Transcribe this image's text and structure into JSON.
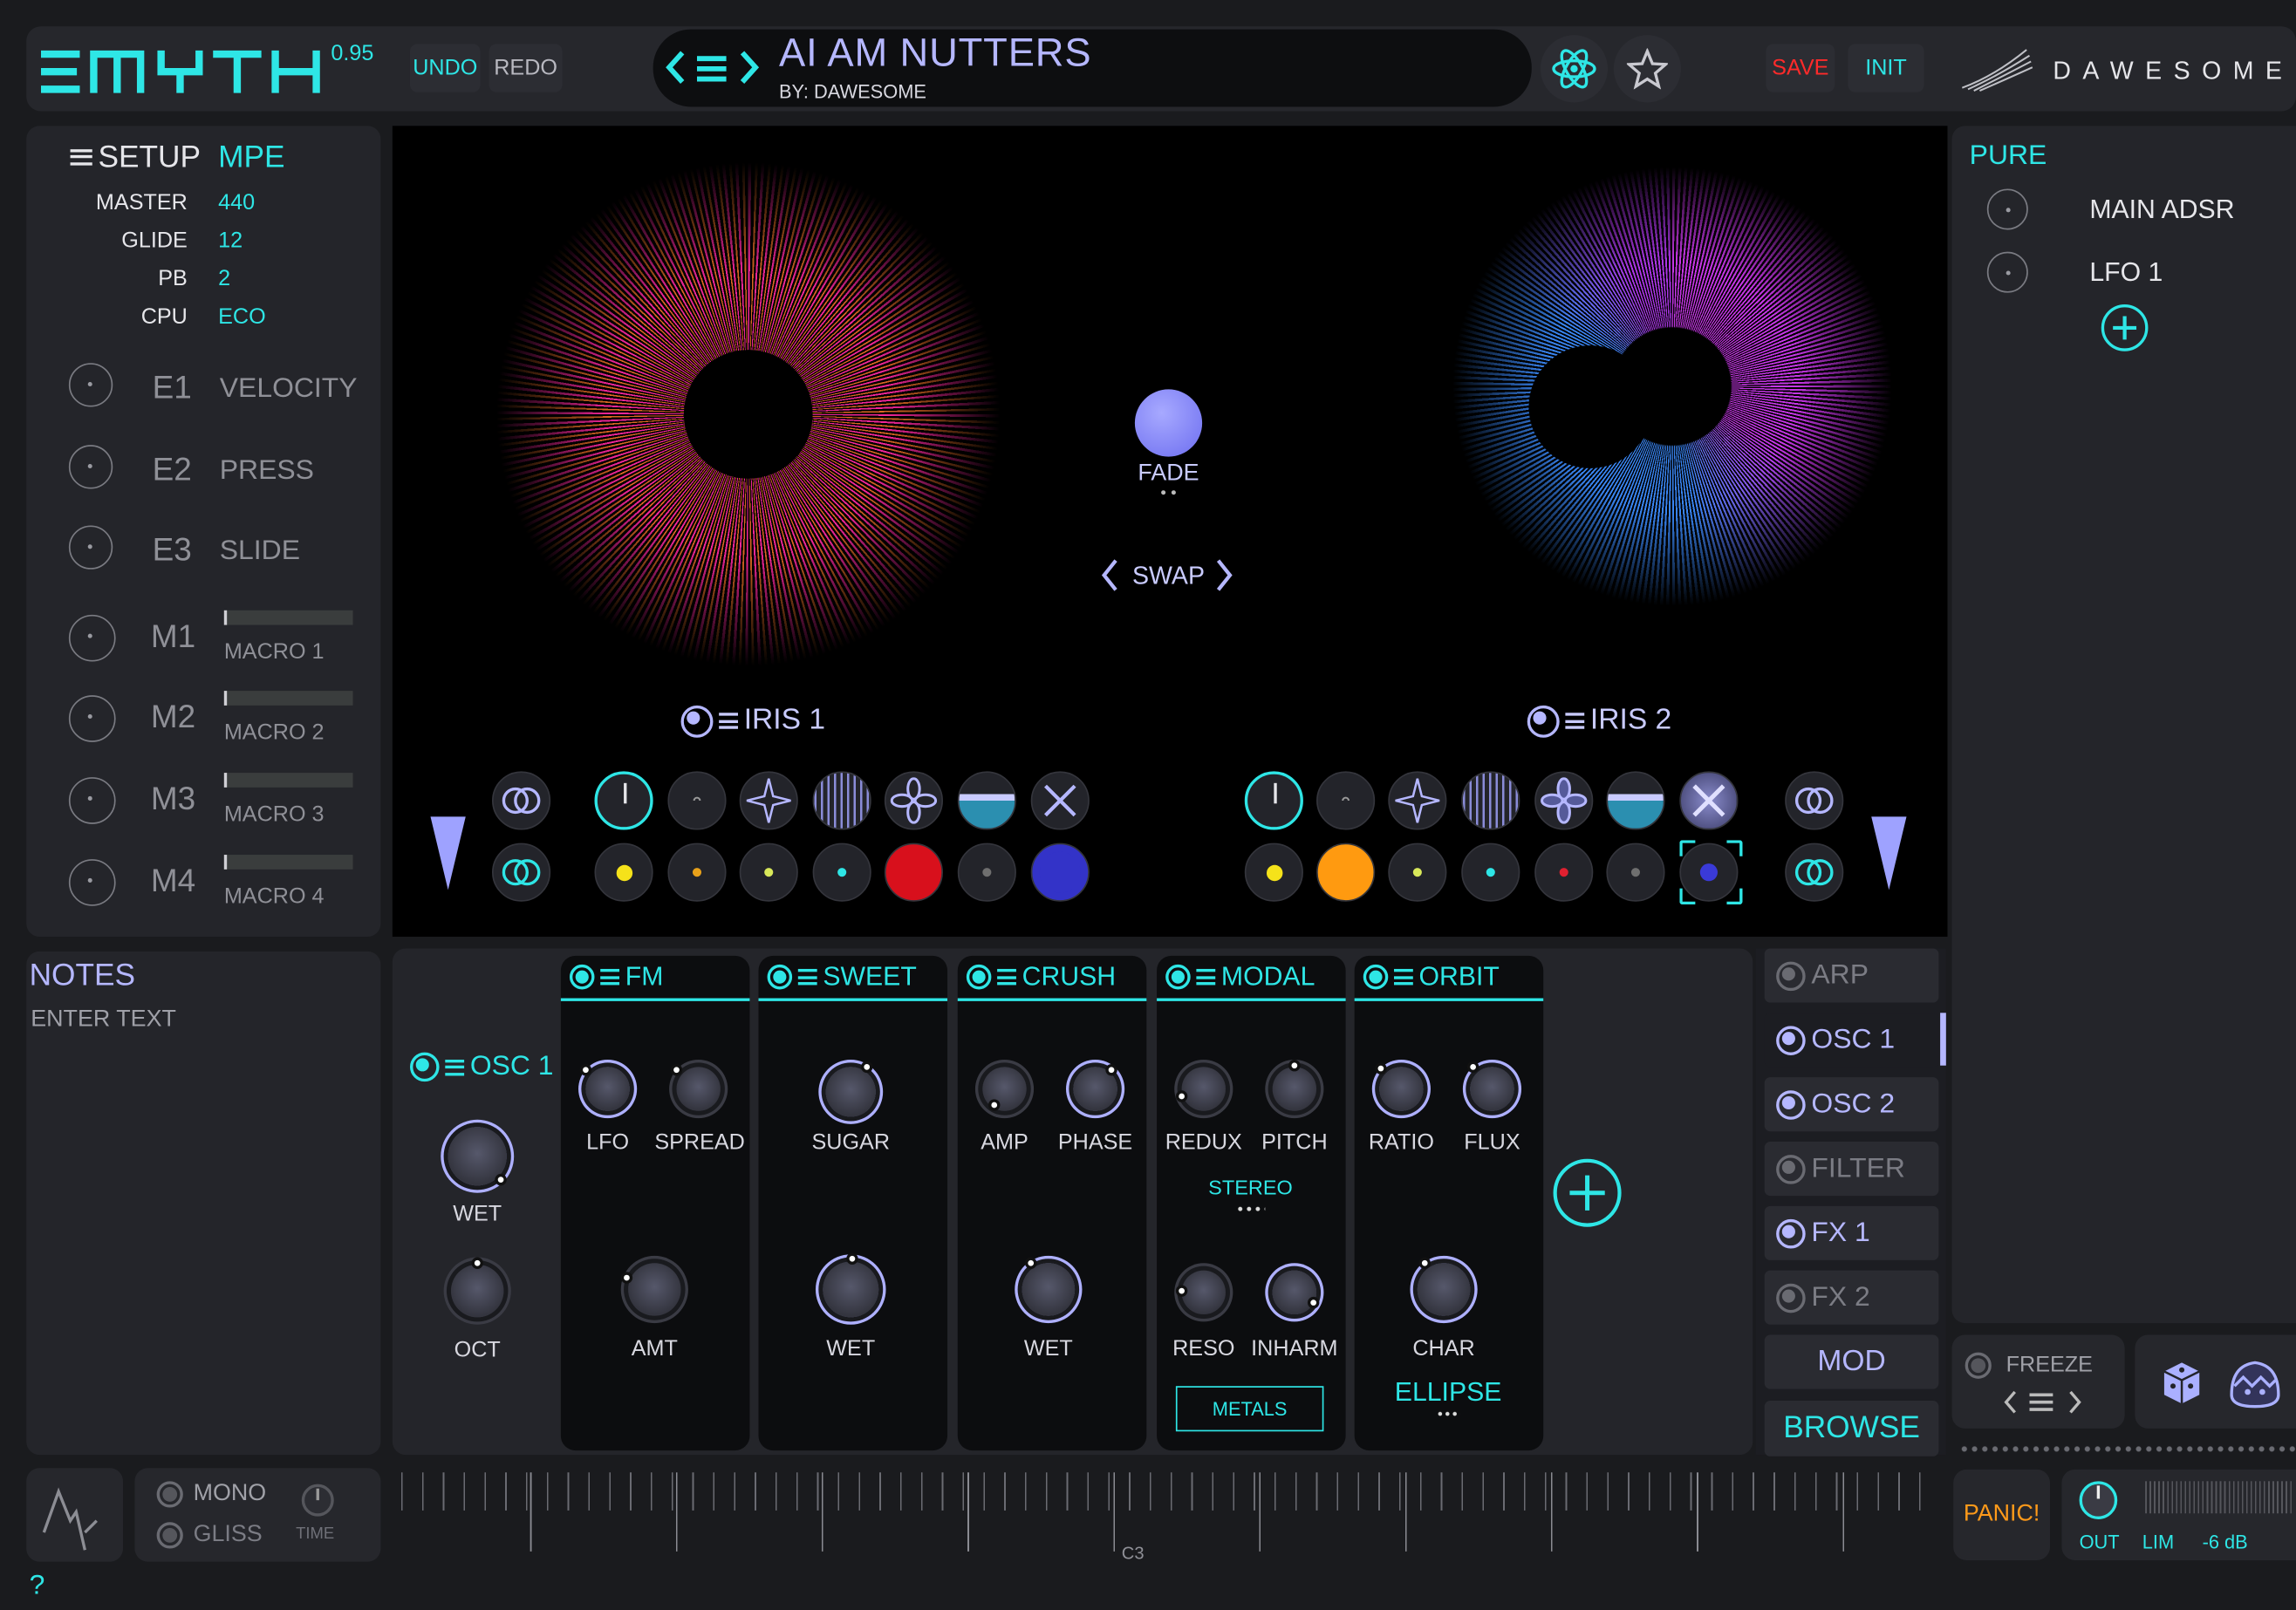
{
  "header": {
    "logo": "MYTH",
    "version": "0.95",
    "undo": "UNDO",
    "redo": "REDO",
    "preset_name": "AI AM NUTTERS",
    "preset_author": "BY: DAWESOME",
    "save": "SAVE",
    "init": "INIT",
    "brand": "DAWESOME"
  },
  "setup": {
    "title": "SETUP",
    "mode": "MPE",
    "params": [
      {
        "label": "MASTER",
        "value": "440"
      },
      {
        "label": "GLIDE",
        "value": "12"
      },
      {
        "label": "PB",
        "value": "2"
      },
      {
        "label": "CPU",
        "value": "ECO"
      }
    ],
    "expressions": [
      {
        "id": "E1",
        "label": "VELOCITY"
      },
      {
        "id": "E2",
        "label": "PRESS"
      },
      {
        "id": "E3",
        "label": "SLIDE"
      }
    ],
    "macros": [
      {
        "id": "M1",
        "label": "MACRO 1",
        "level": 0.0
      },
      {
        "id": "M2",
        "label": "MACRO 2",
        "level": 0.0
      },
      {
        "id": "M3",
        "label": "MACRO 3",
        "level": 0.0
      },
      {
        "id": "M4",
        "label": "MACRO 4",
        "level": 0.0
      }
    ]
  },
  "notes": {
    "title": "NOTES",
    "placeholder": "ENTER TEXT"
  },
  "center": {
    "fade_label": "FADE",
    "swap_label": "SWAP",
    "iris1_label": "IRIS 1",
    "iris2_label": "IRIS 2"
  },
  "iris1_dots": [
    "#f5e21a",
    "#e8a11a",
    "#d8e85a",
    "#2ee6e6",
    "#d8101c",
    "#6f6f6f",
    "#3333c8"
  ],
  "iris2_dots": [
    "#f5e21a",
    "#ff9a10",
    "#d8e85a",
    "#2ee6e6",
    "#e02030",
    "#6f6f6f",
    "#3a3ad8"
  ],
  "osc": {
    "title": "OSC 1",
    "wet": "WET",
    "oct": "OCT"
  },
  "fx_cards": [
    {
      "title": "FM",
      "knobs": [
        "LFO",
        "SPREAD"
      ],
      "bottom": "AMT"
    },
    {
      "title": "SWEET",
      "knobs": [
        "SUGAR"
      ],
      "bottom": "WET"
    },
    {
      "title": "CRUSH",
      "knobs": [
        "AMP",
        "PHASE"
      ],
      "bottom": "WET"
    },
    {
      "title": "MODAL",
      "knobs": [
        "REDUX",
        "PITCH"
      ],
      "middle": "STEREO",
      "bottom_knobs": [
        "RESO",
        "INHARM"
      ],
      "button": "METALS"
    },
    {
      "title": "ORBIT",
      "knobs": [
        "RATIO",
        "FLUX"
      ],
      "bottom": "CHAR",
      "mode": "ELLIPSE"
    }
  ],
  "right_nav": [
    {
      "label": "ARP",
      "enabled": false
    },
    {
      "label": "OSC 1",
      "enabled": true
    },
    {
      "label": "OSC 2",
      "enabled": true
    },
    {
      "label": "FILTER",
      "enabled": false
    },
    {
      "label": "FX 1",
      "enabled": true
    },
    {
      "label": "FX 2",
      "enabled": false
    }
  ],
  "mod_button": "MOD",
  "browse_button": "BROWSE",
  "mod_panel": {
    "title": "PURE",
    "items": [
      "MAIN ADSR",
      "LFO 1"
    ]
  },
  "freeze": "FREEZE",
  "bottom": {
    "mono": "MONO",
    "gliss": "GLISS",
    "time": "TIME",
    "keyboard_label": "C3",
    "panic": "PANIC!",
    "out": "OUT",
    "lim": "LIM",
    "db": "-6 dB",
    "help": "?"
  },
  "colors": {
    "accent": "#2ee6e6",
    "secondary": "#b5b7ff",
    "save": "#ff2a2a",
    "panic": "#ff9a1a"
  }
}
